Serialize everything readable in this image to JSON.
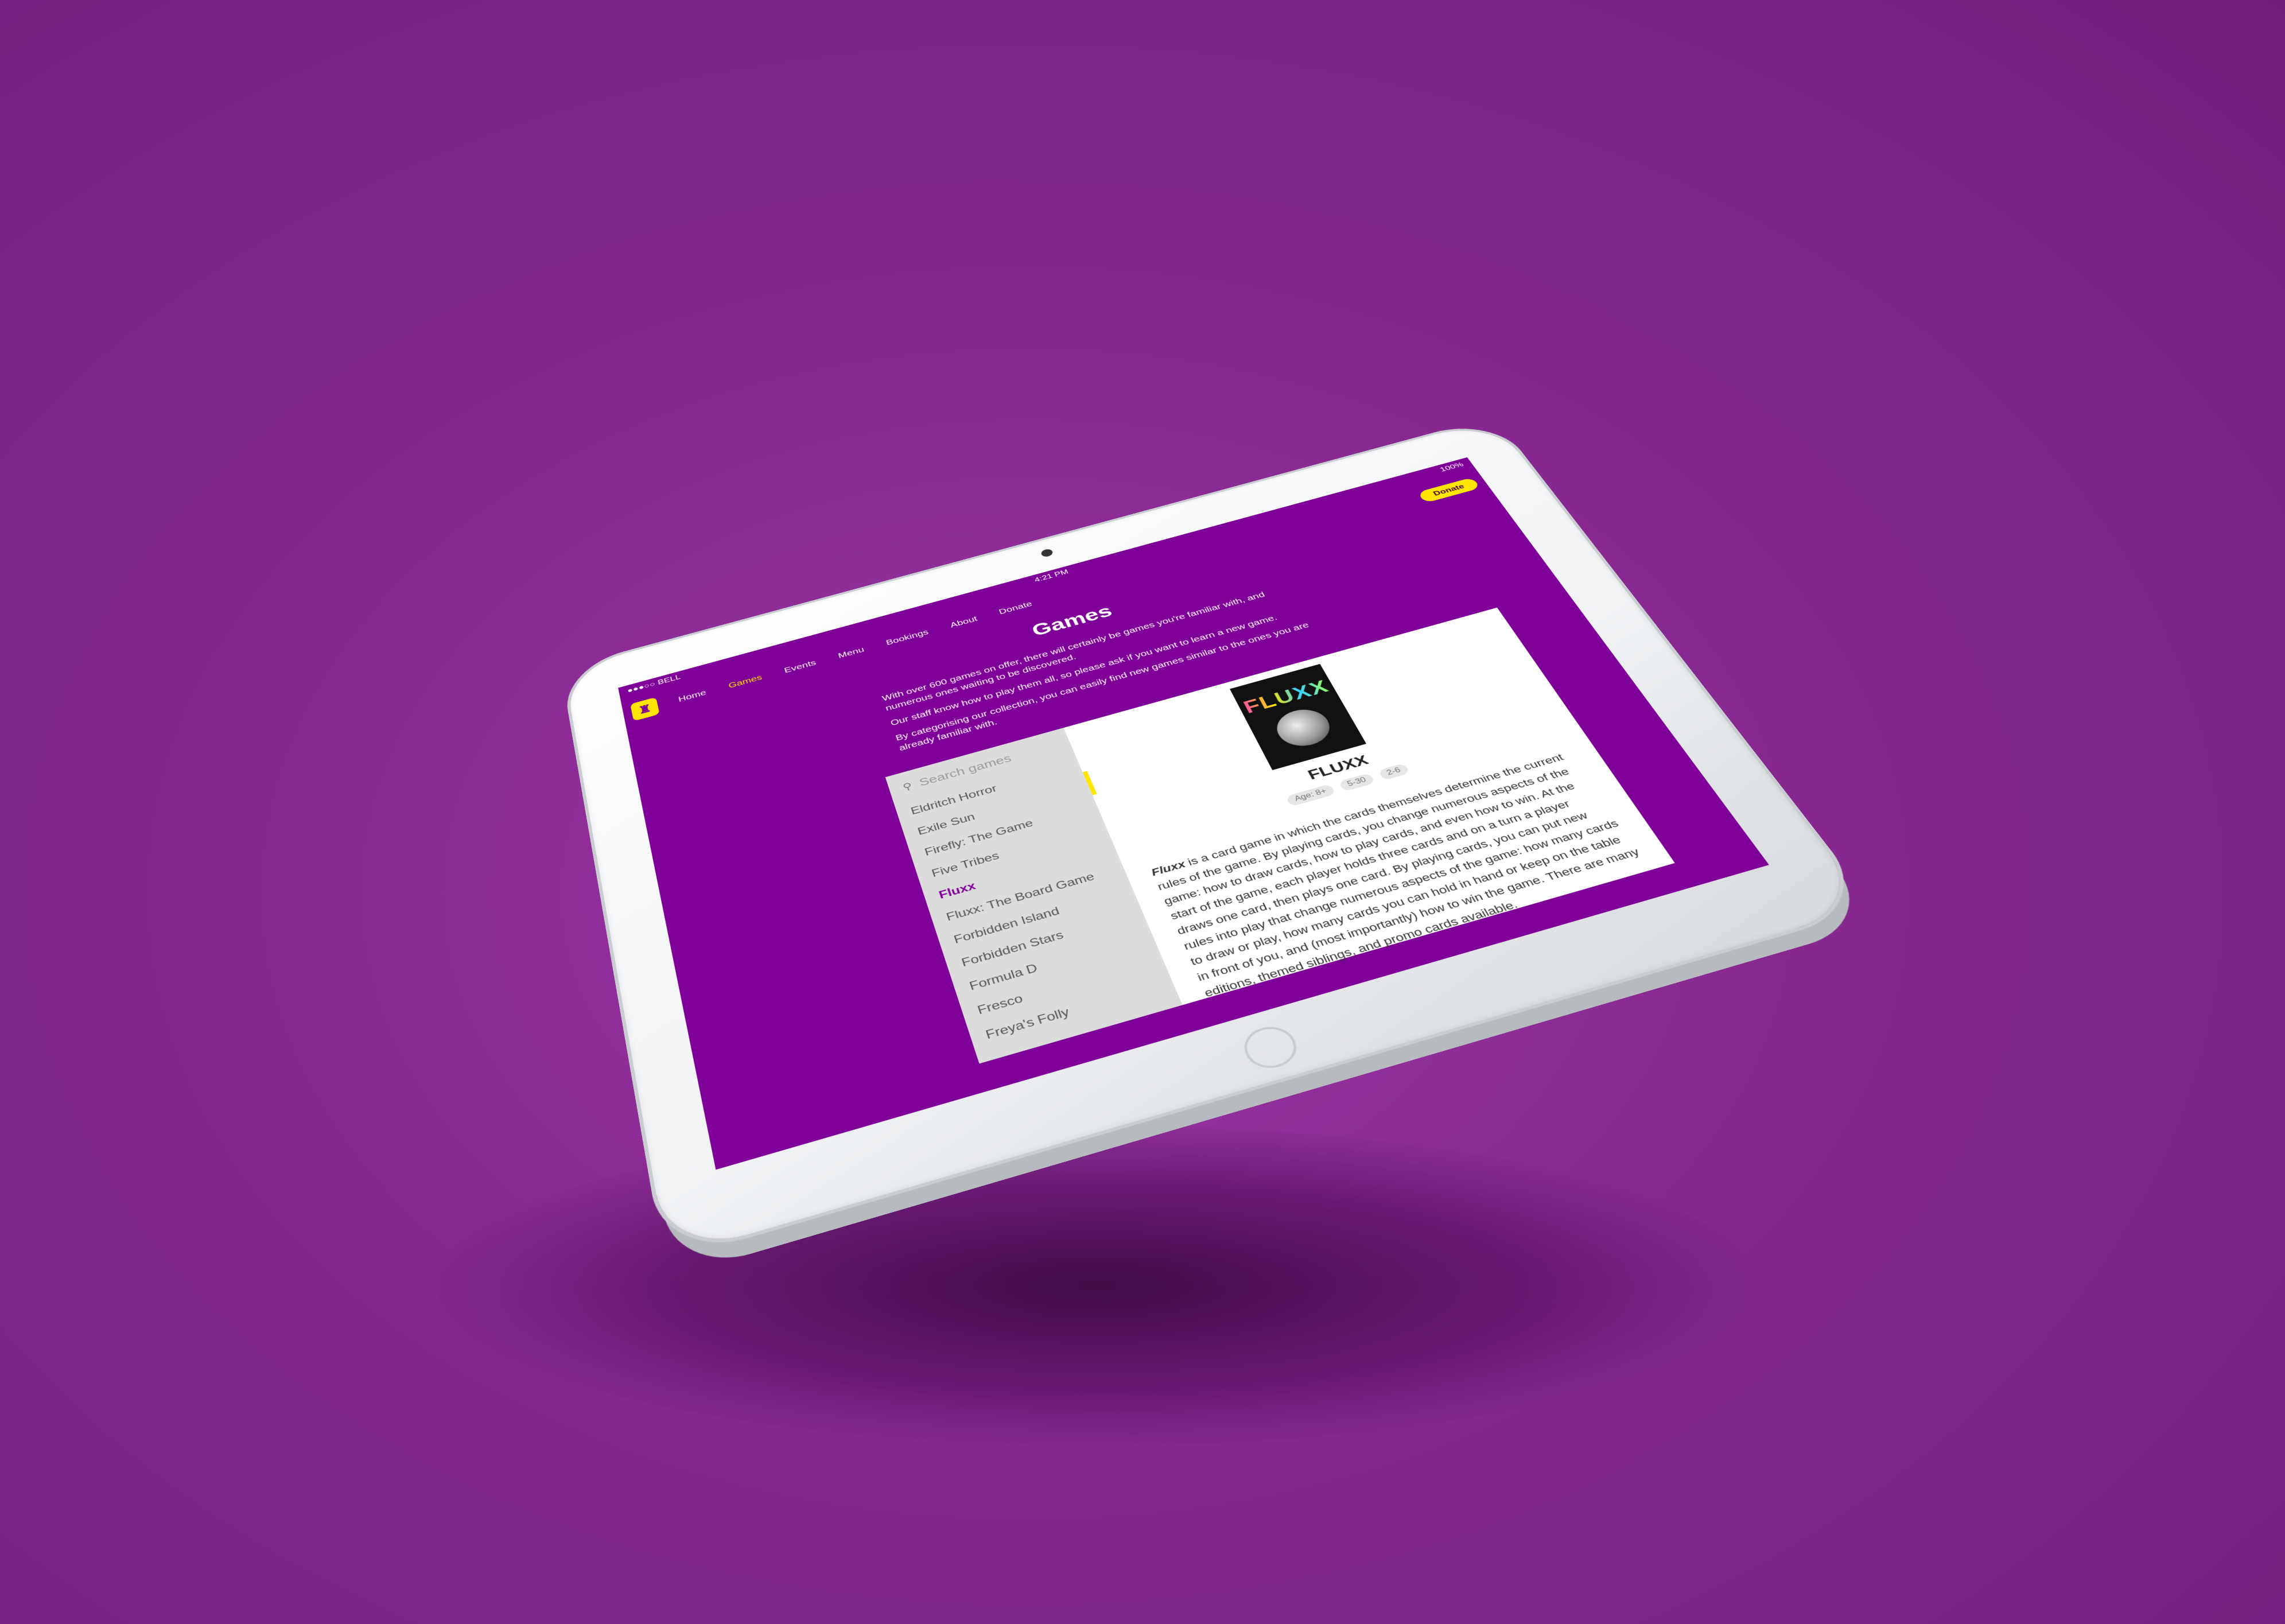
{
  "status": {
    "carrier": "●●●○○ BELL",
    "time": "4:21 PM",
    "battery": "100%"
  },
  "nav": {
    "items": [
      "Home",
      "Games",
      "Events",
      "Menu",
      "Bookings",
      "About",
      "Donate"
    ],
    "active": "Games",
    "donate_button": "Donate"
  },
  "page": {
    "title": "Games",
    "intro": [
      "With over 600 games on offer, there will certainly be games you're familiar with, and numerous ones waiting to be discovered.",
      "Our staff know how to play them all, so please ask if you want to learn a new game.",
      "By categorising our collection, you can easily find new games similar to the ones you are already familiar with."
    ]
  },
  "search": {
    "placeholder": "Search games"
  },
  "games": [
    "Eldritch Horror",
    "Exile Sun",
    "Firefly: The Game",
    "Five Tribes",
    "Fluxx",
    "Fluxx: The Board Game",
    "Forbidden Island",
    "Forbidden Stars",
    "Formula D",
    "Fresco",
    "Freya's Folly"
  ],
  "selected_game": "Fluxx",
  "detail": {
    "cover_text": "FLUXX",
    "title": "FLUXX",
    "badges": [
      "Age: 8+",
      "5-30",
      "2-6"
    ],
    "name_in_text": "Fluxx",
    "description": " is a card game in which the cards themselves determine the current rules of the game. By playing cards, you change numerous aspects of the game: how to draw cards, how to play cards, and even how to win. At the start of the game, each player holds three cards and on a turn a player draws one card, then plays one card. By playing cards, you can put new rules into play that change numerous aspects of the game: how many cards to draw or play, how many cards you can hold in hand or keep on the table in front of you, and (most importantly) how to win the game. There are many editions, themed siblings, and promo cards available."
  },
  "colors": {
    "brand_purple": "#7f0098",
    "accent_yellow": "#ffe600",
    "background": "#8e2a99"
  }
}
